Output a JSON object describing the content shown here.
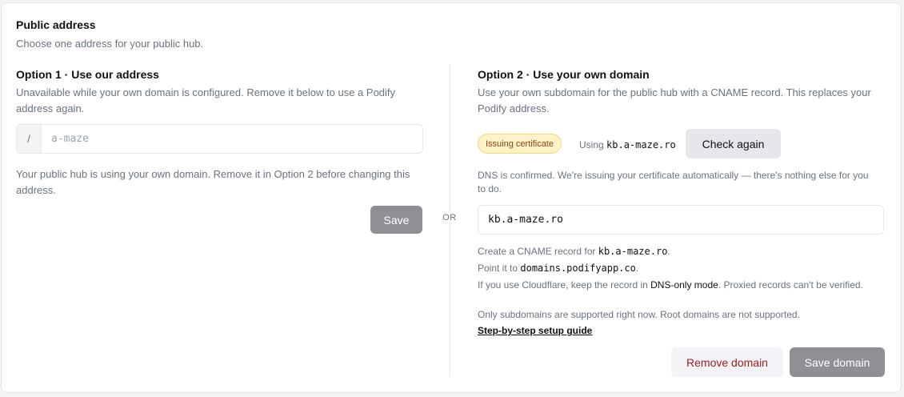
{
  "header": {
    "title": "Public address",
    "subtitle": "Choose one address for your public hub."
  },
  "option1": {
    "title": "Option 1 · Use our address",
    "description": "Unavailable while your own domain is configured. Remove it below to use a Podify address again.",
    "prefix": "/",
    "input_placeholder": "a-maze",
    "note": "Your public hub is using your own domain. Remove it in Option 2 before changing this address.",
    "save_label": "Save"
  },
  "divider": {
    "label": "OR"
  },
  "option2": {
    "title": "Option 2 · Use your own domain",
    "description": "Use your own subdomain for the public hub with a CNAME record. This replaces your Podify address.",
    "status_badge": "Issuing certificate",
    "using_prefix": "Using",
    "using_domain": "kb.a-maze.ro",
    "check_again_label": "Check again",
    "dns_note": "DNS is confirmed. We're issuing your certificate automatically — there's nothing else for you to do.",
    "domain_value": "kb.a-maze.ro",
    "help": {
      "cname_prefix": "Create a CNAME record for ",
      "cname_domain": "kb.a-maze.ro",
      "cname_suffix": ".",
      "point_prefix": "Point it to ",
      "point_target": "domains.podifyapp.co",
      "point_suffix": ".",
      "cloudflare_prefix": "If you use Cloudflare, keep the record in ",
      "cloudflare_mode": "DNS-only mode",
      "cloudflare_suffix": ". Proxied records can't be verified.",
      "subdomains": "Only subdomains are supported right now. Root domains are not supported.",
      "guide_link": "Step-by-step setup guide"
    },
    "remove_label": "Remove domain",
    "save_domain_label": "Save domain"
  },
  "colors": {
    "badge_bg": "#fef3c7",
    "badge_text": "#92400e",
    "remove_text": "#9b1c1c",
    "disabled_button": "#8f9094"
  }
}
